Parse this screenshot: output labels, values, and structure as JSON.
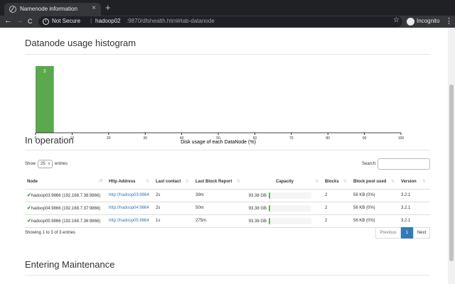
{
  "browser": {
    "tab_title": "Namenode information",
    "close_glyph": "×",
    "new_tab_glyph": "+",
    "url_secure_label": "Not Secure",
    "url_separator": "|",
    "url_host": "hadoop02",
    "url_path": ":9870/dfshealth.html#tab-datanode",
    "incognito_label": "Incognito",
    "back_glyph": "←",
    "forward_glyph": "→",
    "reload_glyph": "C",
    "star_glyph": "☆",
    "menu_glyph": "⋮"
  },
  "histogram": {
    "heading": "Datanode usage histogram",
    "chart_data": {
      "type": "bar",
      "title": "",
      "xlabel": "Disk usage of each DataNode (%)",
      "ylabel": "",
      "xlim": [
        0,
        100
      ],
      "xticks": [
        "0",
        "10",
        "20",
        "30",
        "40",
        "50",
        "60",
        "70",
        "80",
        "90",
        "100"
      ],
      "bins": [
        {
          "x0": 0,
          "x1": 5,
          "count": 3
        }
      ],
      "bar_color": "#5ca84f",
      "ymax": 3
    }
  },
  "in_operation": {
    "heading": "In operation",
    "show_label": "Show",
    "entries_value": "25",
    "entries_label": "entries",
    "search_label": "Search:",
    "columns": [
      "Node",
      "Http Address",
      "Last contact",
      "Last Block Report",
      "Capacity",
      "Blocks",
      "Block pool used",
      "Version"
    ],
    "rows": [
      {
        "node": "hadoop03:9866 (192.168.7.38:9866)",
        "http": "http://hadoop03:9864",
        "last_contact": "2s",
        "last_block_report": "39m",
        "capacity": "93.38 GB",
        "capacity_used_pct": 1,
        "blocks": "2",
        "block_pool_used": "56 KB (0%)",
        "version": "3.2.1"
      },
      {
        "node": "hadoop04:9866 (192.168.7.37:9866)",
        "http": "http://hadoop04:9864",
        "last_contact": "2s",
        "last_block_report": "50m",
        "capacity": "93.38 GB",
        "capacity_used_pct": 1,
        "blocks": "2",
        "block_pool_used": "56 KB (0%)",
        "version": "3.2.1"
      },
      {
        "node": "hadoop05:9866 (192.168.7.36:9866)",
        "http": "http://hadoop05:9864",
        "last_contact": "1s",
        "last_block_report": "275m",
        "capacity": "93.38 GB",
        "capacity_used_pct": 1,
        "blocks": "2",
        "block_pool_used": "56 KB (0%)",
        "version": "3.2.1"
      }
    ],
    "summary": "Showing 1 to 3 of 3 entries",
    "pagination": {
      "previous": "Previous",
      "current": "1",
      "next": "Next"
    }
  },
  "entering_maintenance": {
    "heading": "Entering Maintenance"
  },
  "colors": {
    "bar_green": "#5ca84f",
    "link_blue": "#337ab7",
    "check_green": "#3c9a3c"
  }
}
